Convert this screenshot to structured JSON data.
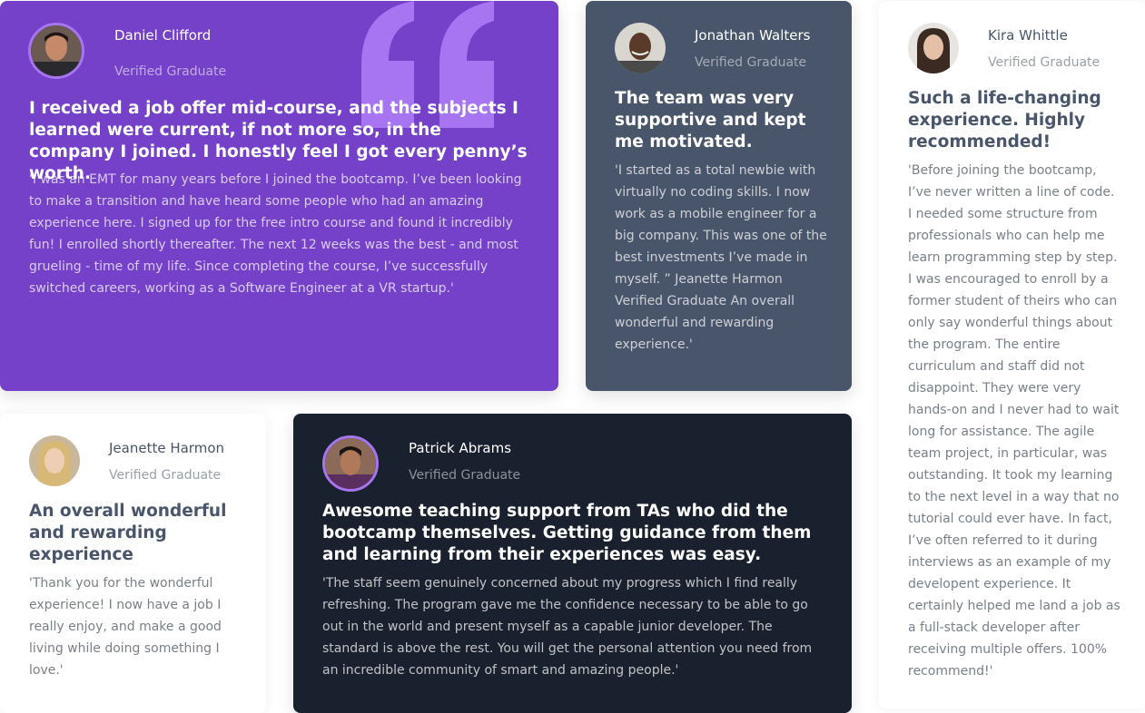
{
  "testimonials": [
    {
      "name": "Daniel Clifford",
      "role": "Verified Graduate",
      "headline": "I received a job offer mid-course, and the subjects I learned were current, if not more so, in the company I joined. I honestly feel I got every penny’s worth.",
      "quote": "'I was an EMT for many years before I joined the bootcamp. I’ve been looking to make a transition and have heard some people who had an amazing experience here. I signed up for the free intro course and found it incredibly fun! I enrolled shortly thereafter. The next 12 weeks was the best - and most grueling - time of my life. Since completing the course, I’ve successfully switched careers, working as a Software Engineer at a VR startup.'"
    },
    {
      "name": "Jonathan Walters",
      "role": "Verified Graduate",
      "headline": "The team was very supportive and kept me motivated.",
      "quote": "'I started as a total newbie with virtually no coding skills. I now work as a mobile engineer for a big company. This was one of the best investments I’ve made in myself. ” Jeanette Harmon Verified Graduate An overall wonderful and rewarding experience.'"
    },
    {
      "name": "Kira Whittle",
      "role": "Verified Graduate",
      "headline": "Such a life-changing experience. Highly recommended!",
      "quote": "'Before joining the bootcamp, I’ve never written a line of code. I needed some structure from professionals who can help me learn programming step by step. I was encouraged to enroll by a former student of theirs who can only say wonderful things about the program. The entire curriculum and staff did not disappoint. They were very hands-on and I never had to wait long for assistance. The agile team project, in particular, was outstanding. It took my learning to the next level in a way that no tutorial could ever have. In fact, I’ve often referred to it during interviews as an example of my developent experience. It certainly helped me land a job as a full-stack developer after receiving multiple offers. 100% recommend!'"
    },
    {
      "name": "Jeanette Harmon",
      "role": "Verified Graduate",
      "headline": "An overall wonderful and rewarding experience",
      "quote": "'Thank you for the wonderful experience! I now have a job I really enjoy, and make a good living while doing something I love.'"
    },
    {
      "name": "Patrick Abrams",
      "role": "Verified Graduate",
      "headline": "Awesome teaching support from TAs who did the bootcamp themselves. Getting guidance from them and learning from their experiences was easy.",
      "quote": "'The staff seem genuinely concerned about my progress which I find really refreshing. The program gave me the confidence necessary to be able to go out in the world and present myself as a capable junior developer. The standard is above the rest. You will get the personal attention you need from an incredible community of smart and amazing people.'"
    }
  ],
  "colors": {
    "purple": "#7541c8",
    "gray": "#48556a",
    "dark": "#19212e",
    "white": "#ffffff",
    "quote_mark": "#a775f1"
  }
}
